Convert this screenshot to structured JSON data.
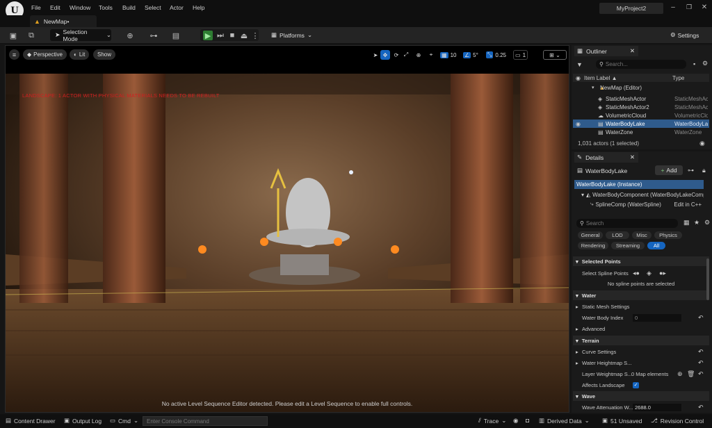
{
  "titlebar": {
    "menu": [
      "File",
      "Edit",
      "Window",
      "Tools",
      "Build",
      "Select",
      "Actor",
      "Help"
    ],
    "project_name": "MyProject2",
    "map_tab": "NewMap•"
  },
  "toolbar": {
    "selection_mode": "Selection Mode",
    "platforms": "Platforms",
    "settings": "Settings"
  },
  "viewport": {
    "perspective": "Perspective",
    "lit": "Lit",
    "show": "Show",
    "grid_snap": "10",
    "rotation_snap": "5°",
    "scale_snap": "0.25",
    "camera_speed": "1",
    "warning": "LANDSCAPE: 1 ACTOR WITH PHYSICAL MATERIALS NEEDS TO BE REBUILT",
    "sequence_message": "No active Level Sequence Editor detected. Please edit a Level Sequence to enable full controls."
  },
  "outliner": {
    "tab": "Outliner",
    "search_placeholder": "Search...",
    "col_label": "Item Label ▲",
    "col_type": "Type",
    "root": "NewMap (Editor)",
    "rows": [
      {
        "label": "StaticMeshActor",
        "type": "StaticMeshActor"
      },
      {
        "label": "StaticMeshActor2",
        "type": "StaticMeshActor"
      },
      {
        "label": "VolumetricCloud",
        "type": "VolumetricCloud"
      },
      {
        "label": "WaterBodyLake",
        "type": "WaterBodyLake"
      },
      {
        "label": "WaterZone",
        "type": "WaterZone"
      }
    ],
    "count": "1,031 actors (1 selected)"
  },
  "details": {
    "tab": "Details",
    "actor_name": "WaterBodyLake",
    "add_button": "Add",
    "instance": "WaterBodyLake (Instance)",
    "component": "WaterBodyComponent (WaterBodyLakeComponent)",
    "spline": "SplineComp (WaterSpline)",
    "edit_cpp": "Edit in C++",
    "search_placeholder": "Search",
    "categories": [
      "General",
      "LOD",
      "Misc",
      "Physics",
      "Rendering",
      "Streaming",
      "All"
    ],
    "selected_points_section": "Selected Points",
    "select_spline_points": "Select Spline Points",
    "no_points": "No spline points are selected",
    "water_section": "Water",
    "static_mesh_settings": "Static Mesh Settings",
    "water_body_index": "Water Body Index",
    "water_body_index_value": "0",
    "advanced": "Advanced",
    "terrain_section": "Terrain",
    "curve_settings": "Curve Settings",
    "water_heightmap": "Water Heightmap S...",
    "layer_weightmap": "Layer Weightmap S...",
    "layer_weightmap_value": "0 Map elements",
    "affects_landscape": "Affects Landscape",
    "wave_section": "Wave",
    "wave_attenuation": "Wave Attenuation W...",
    "wave_attenuation_value": "2688.0"
  },
  "bottombar": {
    "content_drawer": "Content Drawer",
    "output_log": "Output Log",
    "cmd": "Cmd",
    "console_placeholder": "Enter Console Command",
    "trace": "Trace",
    "derived_data": "Derived Data",
    "unsaved": "51 Unsaved",
    "revision_control": "Revision Control"
  }
}
